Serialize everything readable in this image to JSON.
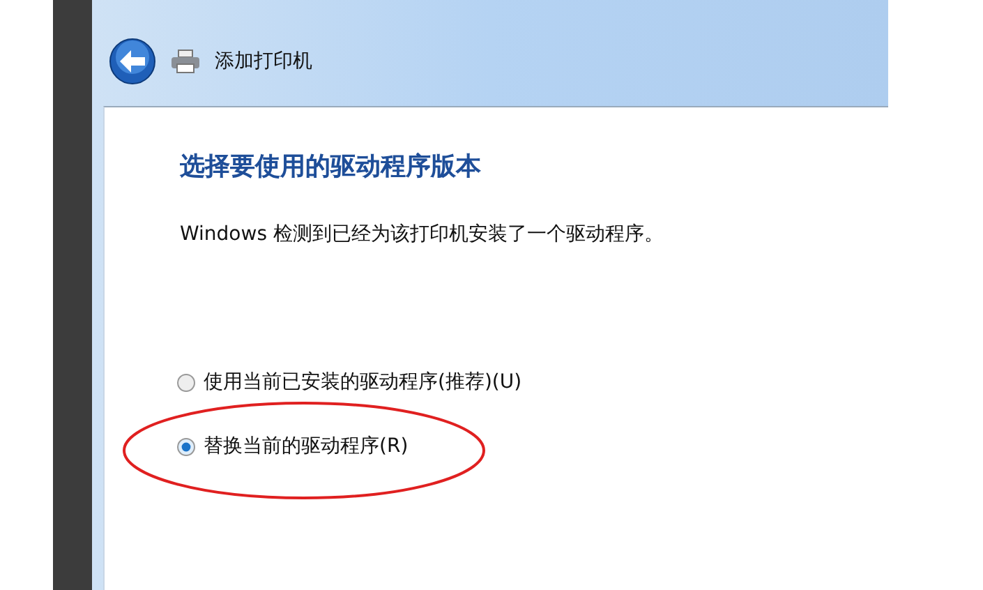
{
  "window": {
    "title": "添加打印机"
  },
  "heading": "选择要使用的驱动程序版本",
  "message": "Windows 检测到已经为该打印机安装了一个驱动程序。",
  "options": [
    {
      "label": "使用当前已安装的驱动程序(推荐)(U)",
      "selected": false,
      "highlighted": false
    },
    {
      "label": "替换当前的驱动程序(R)",
      "selected": true,
      "highlighted": true
    }
  ]
}
